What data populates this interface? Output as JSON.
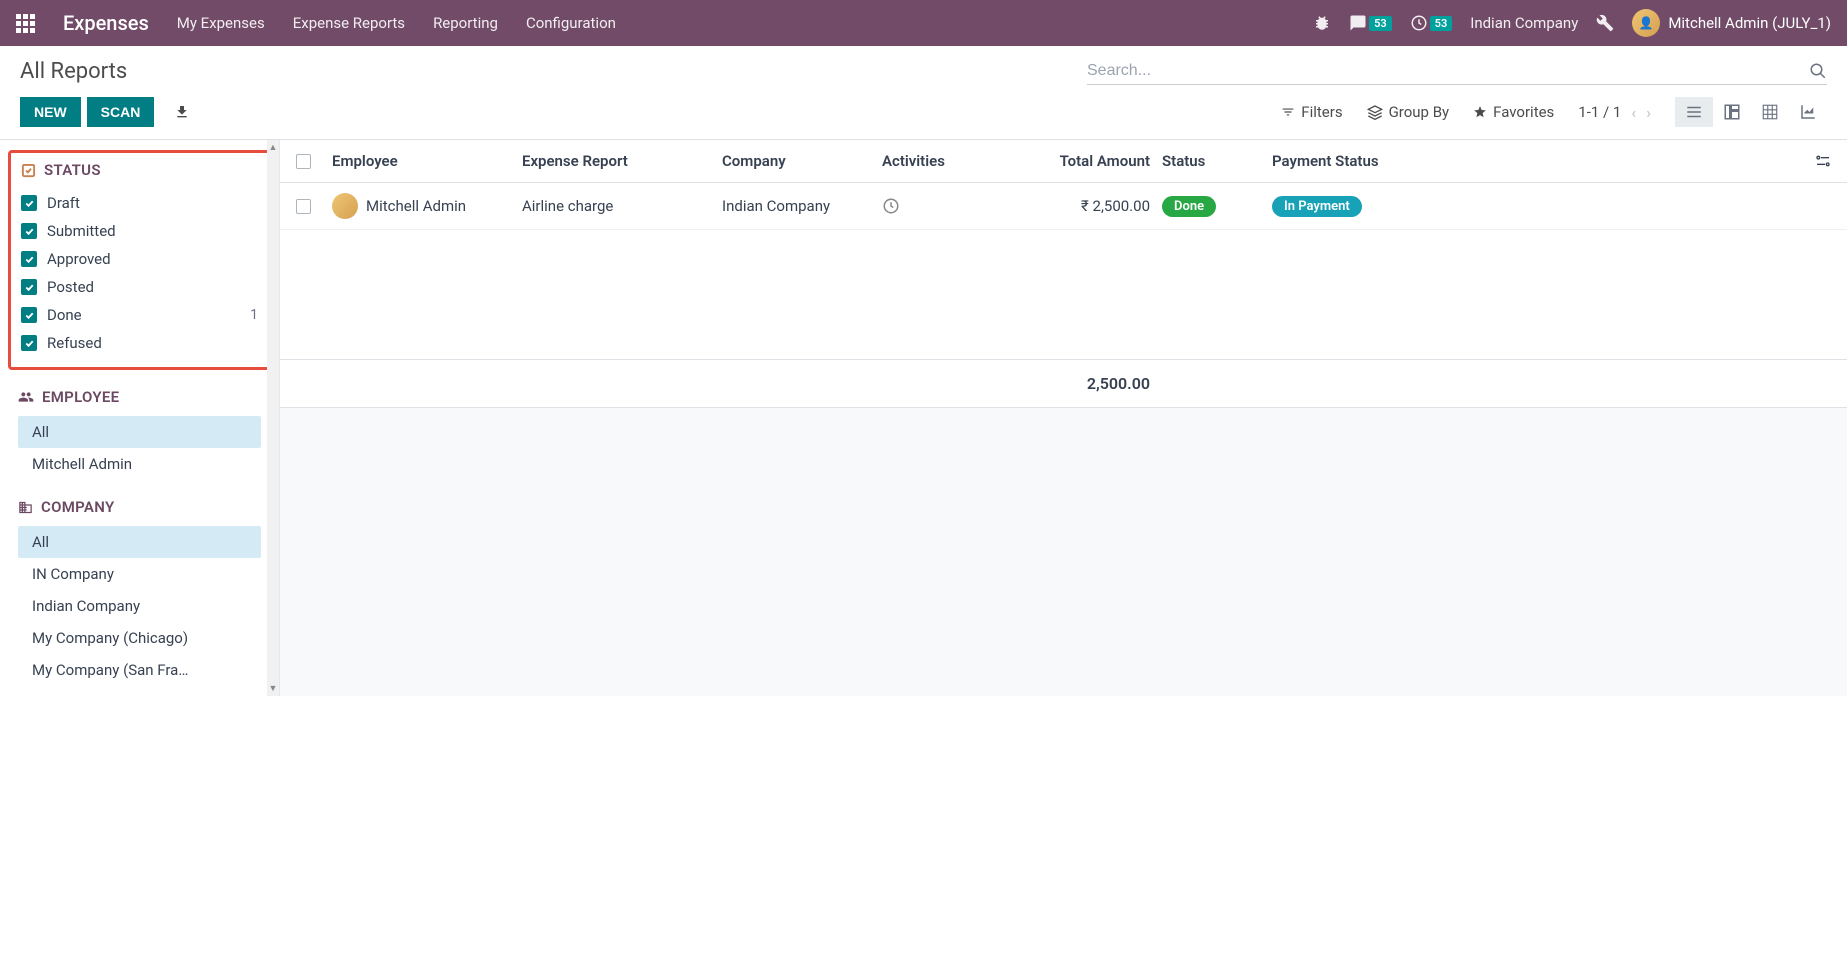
{
  "navbar": {
    "app_title": "Expenses",
    "items": [
      "My Expenses",
      "Expense Reports",
      "Reporting",
      "Configuration"
    ],
    "messages_badge": "53",
    "activities_badge": "53",
    "company": "Indian Company",
    "user": "Mitchell Admin (JULY_1)"
  },
  "breadcrumb": "All Reports",
  "buttons": {
    "new": "NEW",
    "scan": "SCAN"
  },
  "search": {
    "placeholder": "Search..."
  },
  "toolbar": {
    "filters": "Filters",
    "group_by": "Group By",
    "favorites": "Favorites",
    "pager": "1-1 / 1"
  },
  "sidebar": {
    "status": {
      "title": "STATUS",
      "items": [
        {
          "label": "Draft",
          "count": ""
        },
        {
          "label": "Submitted",
          "count": ""
        },
        {
          "label": "Approved",
          "count": ""
        },
        {
          "label": "Posted",
          "count": ""
        },
        {
          "label": "Done",
          "count": "1"
        },
        {
          "label": "Refused",
          "count": ""
        }
      ]
    },
    "employee": {
      "title": "EMPLOYEE",
      "items": [
        "All",
        "Mitchell Admin"
      ]
    },
    "company": {
      "title": "COMPANY",
      "items": [
        "All",
        "IN Company",
        "Indian Company",
        "My Company (Chicago)",
        "My Company (San Fra…"
      ]
    }
  },
  "table": {
    "headers": {
      "employee": "Employee",
      "report": "Expense Report",
      "company": "Company",
      "activities": "Activities",
      "amount": "Total Amount",
      "status": "Status",
      "payment": "Payment Status"
    },
    "rows": [
      {
        "employee": "Mitchell Admin",
        "report": "Airline charge",
        "company": "Indian Company",
        "amount": "₹ 2,500.00",
        "status": "Done",
        "payment": "In Payment"
      }
    ],
    "footer_total": "2,500.00"
  }
}
